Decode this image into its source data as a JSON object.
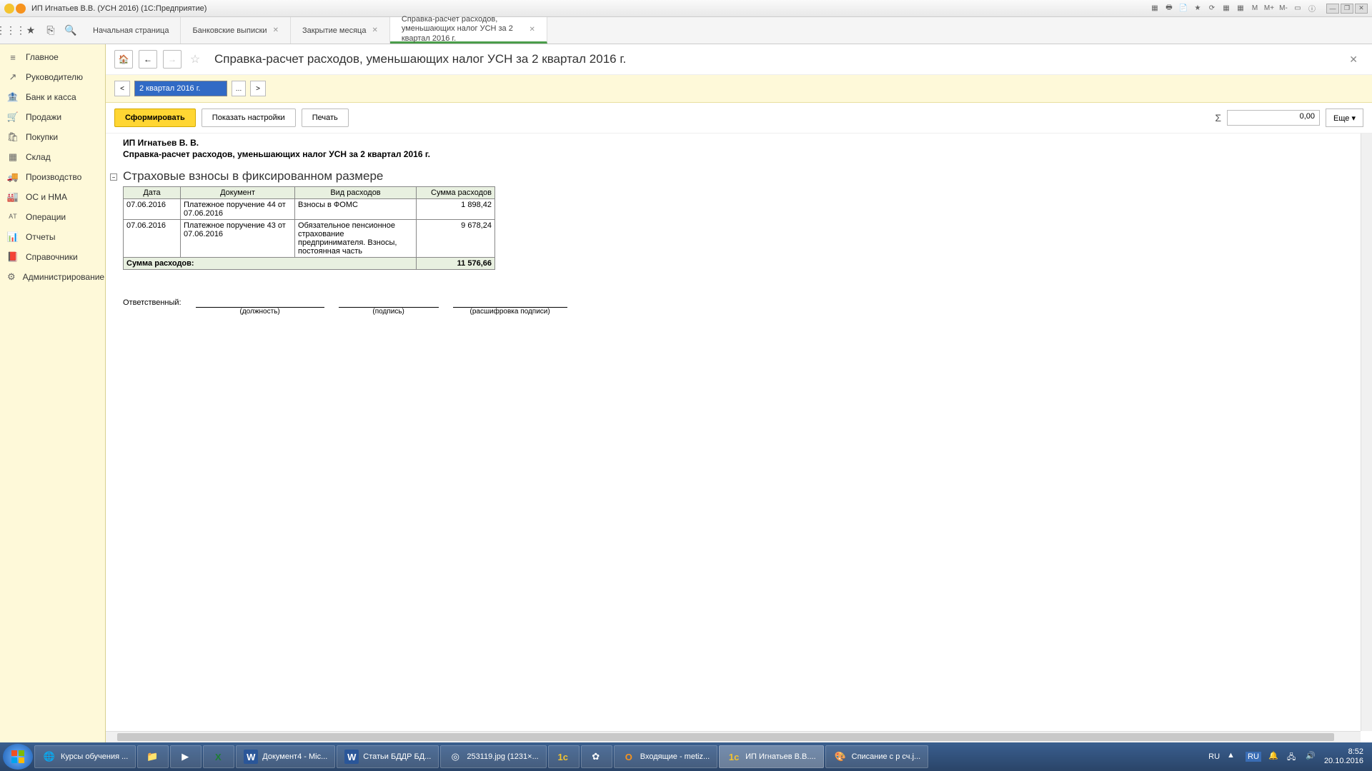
{
  "titlebar": {
    "title": "ИП Игнатьев В.В. (УСН 2016)  (1С:Предприятие)",
    "m_labels": [
      "M",
      "M+",
      "M-"
    ]
  },
  "tool_icons": [
    "apps",
    "star",
    "link",
    "search"
  ],
  "tabs": [
    {
      "label": "Начальная страница",
      "closable": false,
      "active": false
    },
    {
      "label": "Банковские выписки",
      "closable": true,
      "active": false
    },
    {
      "label": "Закрытие месяца",
      "closable": true,
      "active": false
    },
    {
      "label": "Справка-расчет расходов, уменьшающих налог УСН  за 2 квартал 2016 г.",
      "closable": true,
      "active": true
    }
  ],
  "sidebar": [
    {
      "icon": "≡",
      "label": "Главное"
    },
    {
      "icon": "↗",
      "label": "Руководителю"
    },
    {
      "icon": "🏦",
      "label": "Банк и касса"
    },
    {
      "icon": "🛒",
      "label": "Продажи"
    },
    {
      "icon": "🛍",
      "label": "Покупки"
    },
    {
      "icon": "▦",
      "label": "Склад"
    },
    {
      "icon": "🚚",
      "label": "Производство"
    },
    {
      "icon": "🏭",
      "label": "ОС и НМА"
    },
    {
      "icon": "ᴬᵀ",
      "label": "Операции"
    },
    {
      "icon": "📊",
      "label": "Отчеты"
    },
    {
      "icon": "📕",
      "label": "Справочники"
    },
    {
      "icon": "⚙",
      "label": "Администрирование"
    }
  ],
  "header": {
    "title": "Справка-расчет расходов, уменьшающих налог УСН  за 2 квартал 2016 г."
  },
  "period": {
    "value": "2 квартал 2016 г.",
    "prev": "<",
    "next": ">"
  },
  "actions": {
    "generate": "Сформировать",
    "settings": "Показать настройки",
    "print": "Печать",
    "sum_symbol": "Σ",
    "sum_value": "0,00",
    "more": "Еще ▾"
  },
  "report": {
    "org": "ИП Игнатьев В. В.",
    "title": "Справка-расчет расходов, уменьшающих налог УСН  за 2 квартал 2016 г.",
    "section": "Страховые взносы в фиксированном размере",
    "columns": [
      "Дата",
      "Документ",
      "Вид расходов",
      "Сумма расходов"
    ],
    "rows": [
      {
        "date": "07.06.2016",
        "doc": "Платежное поручение 44 от 07.06.2016",
        "type": "Взносы в ФОМС",
        "sum": "1 898,42"
      },
      {
        "date": "07.06.2016",
        "doc": "Платежное поручение 43 от 07.06.2016",
        "type": "Обязательное пенсионное страхование предпринимателя. Взносы, постоянная часть",
        "sum": "9 678,24"
      }
    ],
    "total_label": "Сумма расходов:",
    "total_value": "11 576,66",
    "responsible_label": "Ответственный:",
    "sig_captions": [
      "(должность)",
      "(подпись)",
      "(расшифровка подписи)"
    ]
  },
  "taskbar": [
    {
      "icon": "🌐",
      "label": "Курсы обучения ...",
      "color": "#2a7de1"
    },
    {
      "icon": "📁",
      "label": ""
    },
    {
      "icon": "▶",
      "label": ""
    },
    {
      "icon": "X",
      "label": "",
      "color": "#1e7e34"
    },
    {
      "icon": "W",
      "label": "Документ4 - Mic...",
      "color": "#2a5699"
    },
    {
      "icon": "W",
      "label": "Статьи БДДР БД...",
      "color": "#2a5699"
    },
    {
      "icon": "◎",
      "label": "253119.jpg (1231×...",
      "color": "#f4c430"
    },
    {
      "icon": "1c",
      "label": "",
      "color": "#f4c430"
    },
    {
      "icon": "✿",
      "label": ""
    },
    {
      "icon": "O",
      "label": "Входящие - metiz...",
      "color": "#f7931e"
    },
    {
      "icon": "1c",
      "label": "ИП Игнатьев В.В....",
      "active": true,
      "color": "#f4c430"
    },
    {
      "icon": "🎨",
      "label": "Списание с р сч.j..."
    }
  ],
  "tray": {
    "lang": "RU",
    "lang2": "RU",
    "time": "8:52",
    "date": "20.10.2016"
  }
}
